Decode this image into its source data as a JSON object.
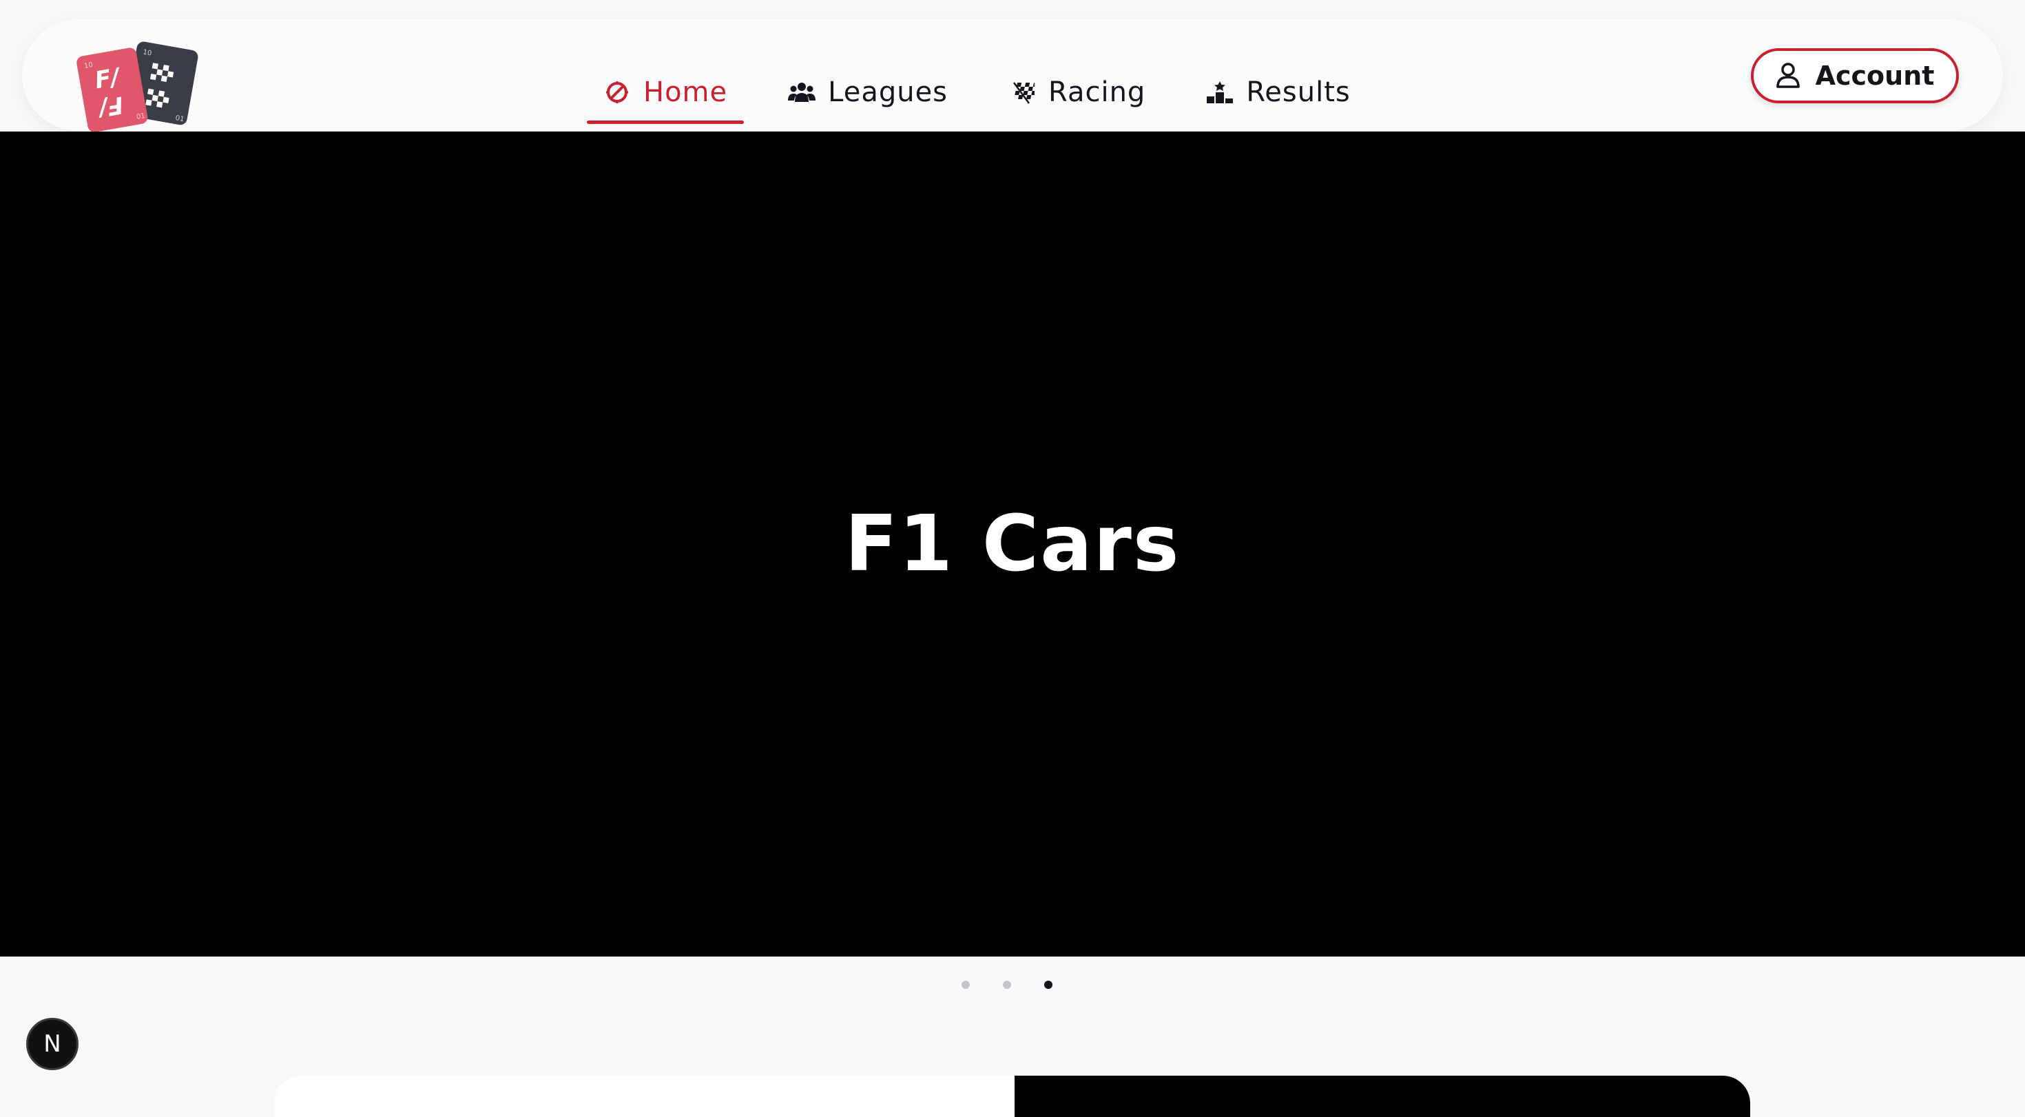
{
  "nav": {
    "items": [
      {
        "label": "Home",
        "icon": "compass-icon",
        "active": true
      },
      {
        "label": "Leagues",
        "icon": "users-icon",
        "active": false
      },
      {
        "label": "Racing",
        "icon": "checkered-flag-icon",
        "active": false
      },
      {
        "label": "Results",
        "icon": "podium-icon",
        "active": false
      }
    ],
    "account_label": "Account"
  },
  "hero": {
    "title": "F1 Cars"
  },
  "carousel": {
    "slide_count": 3,
    "active_index": 2
  },
  "badge": {
    "label": "N"
  },
  "colors": {
    "accent": "#c8202e",
    "text": "#15151e",
    "hero_bg": "#000000",
    "page_bg": "#f7f8fa"
  }
}
